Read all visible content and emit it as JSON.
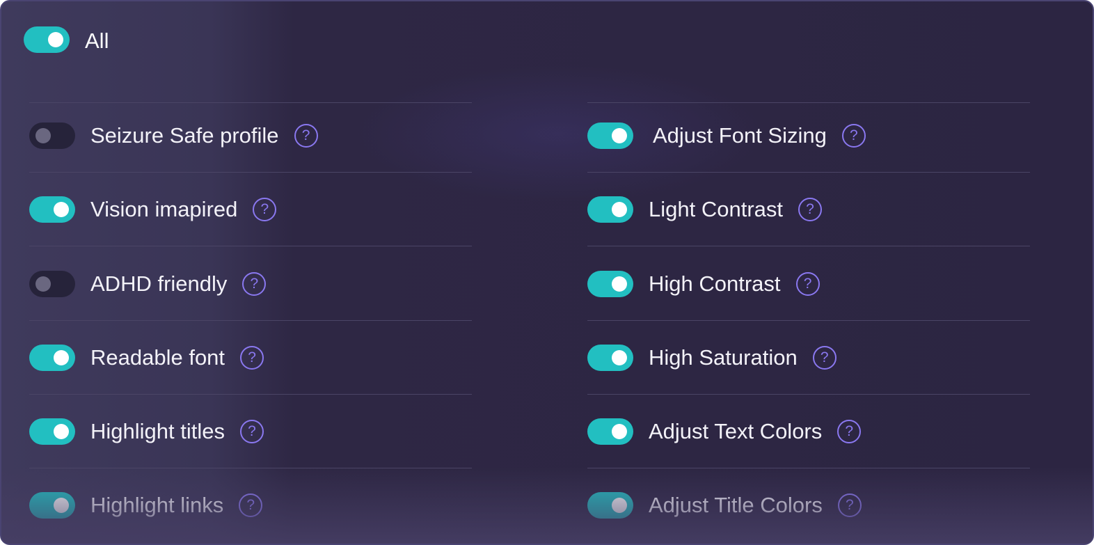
{
  "master": {
    "label": "All",
    "enabled": true
  },
  "help_glyph": "?",
  "left_column": [
    {
      "label": "Seizure Safe profile",
      "enabled": false
    },
    {
      "label": "Vision imapired",
      "enabled": true
    },
    {
      "label": "ADHD friendly",
      "enabled": false
    },
    {
      "label": "Readable font",
      "enabled": true
    },
    {
      "label": "Highlight titles",
      "enabled": true
    },
    {
      "label": "Highlight links",
      "enabled": true
    }
  ],
  "right_column": [
    {
      "label": "Adjust Font Sizing",
      "enabled": true
    },
    {
      "label": "Light Contrast",
      "enabled": true
    },
    {
      "label": "High Contrast",
      "enabled": true
    },
    {
      "label": "High Saturation",
      "enabled": true
    },
    {
      "label": "Adjust Text Colors",
      "enabled": true
    },
    {
      "label": "Adjust Title Colors",
      "enabled": true
    }
  ],
  "colors": {
    "toggle_on": "#22bfc1",
    "toggle_off": "#26233a",
    "help_icon": "#8a78f0",
    "panel_background": "#2c2542"
  }
}
